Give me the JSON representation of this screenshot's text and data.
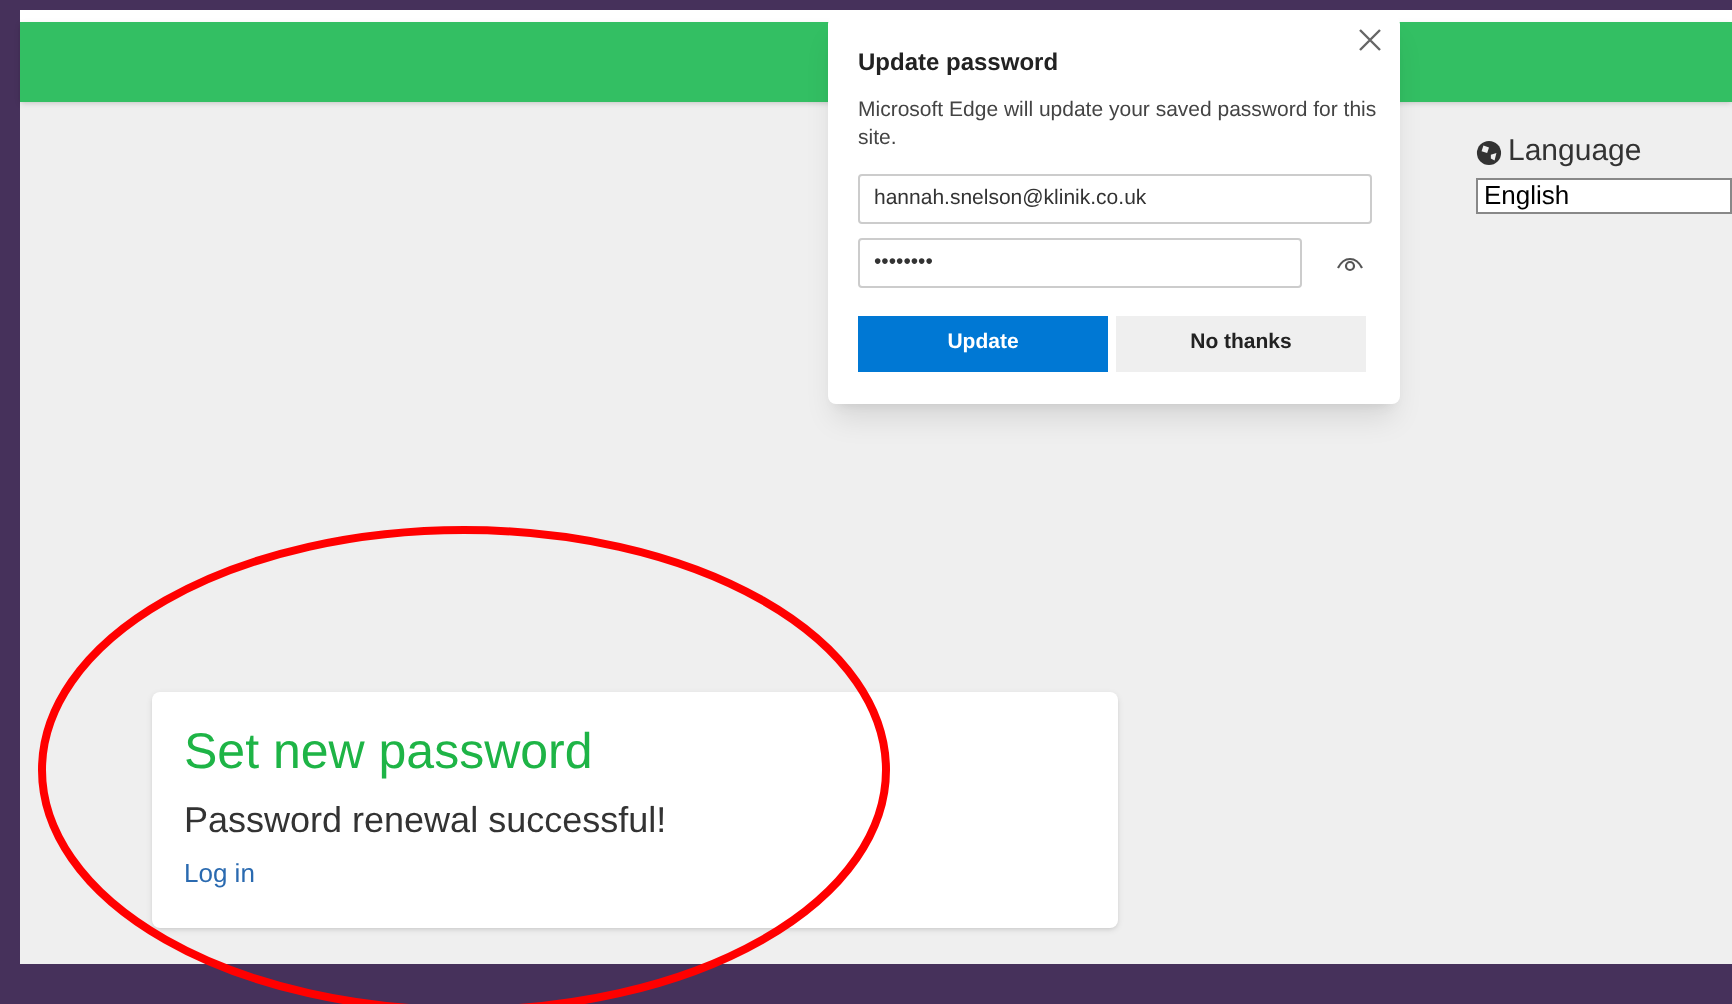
{
  "language": {
    "label": "Language",
    "value": "English"
  },
  "card": {
    "title": "Set new password",
    "message": "Password renewal successful!",
    "link": "Log in"
  },
  "popup": {
    "title": "Update password",
    "description": "Microsoft Edge will update your saved password for this site.",
    "username": "hannah.snelson@klinik.co.uk",
    "password": "••••••••",
    "buttons": [
      {
        "label": "Update",
        "kind": "primary"
      },
      {
        "label": "No thanks",
        "kind": "secondary"
      }
    ]
  }
}
